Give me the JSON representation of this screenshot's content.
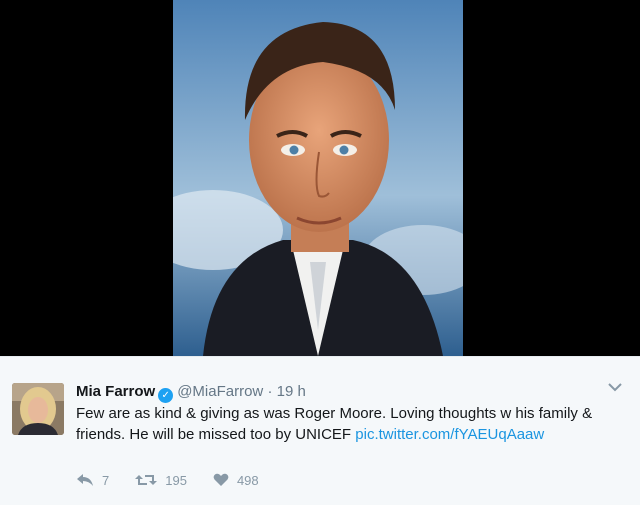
{
  "tweet": {
    "display_name": "Mia Farrow",
    "verified_icon": "verified-badge-icon",
    "handle": "@MiaFarrow",
    "separator": "·",
    "time": "19 h",
    "text": "Few are as kind & giving as was Roger Moore. Loving thoughts w his family & friends. He will be missed too by UNICEF ",
    "link_text": "pic.twitter.com/fYAEUqAaaw",
    "reply_count": "7",
    "retweet_count": "195",
    "like_count": "498"
  },
  "icons": {
    "reply": "reply-icon",
    "retweet": "retweet-icon",
    "like": "heart-icon",
    "more": "chevron-down-icon"
  },
  "colors": {
    "link": "#1b95e0",
    "verified": "#1da1f2",
    "muted": "#8899a6"
  }
}
